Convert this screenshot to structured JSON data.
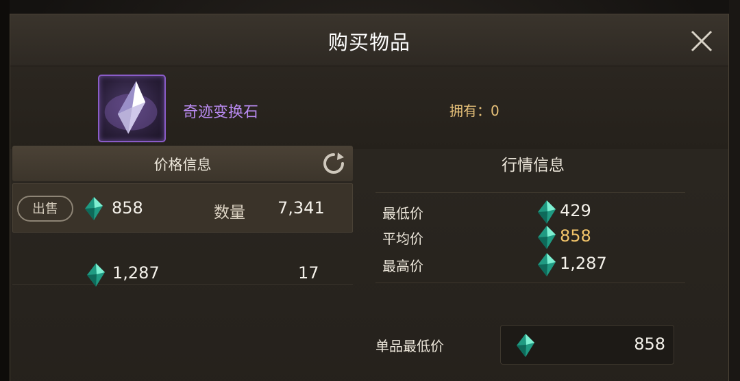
{
  "dialog": {
    "title": "购买物品",
    "close_icon": "close-icon"
  },
  "item": {
    "name": "奇迹变换石",
    "owned_text": "拥有：0",
    "icon": "crystal-icon",
    "rarity_color": "#8a5cc8"
  },
  "price_info": {
    "header": "价格信息",
    "refresh_icon": "refresh-icon",
    "orders": [
      {
        "badge": "出售",
        "price": "858",
        "qty_label": "数量",
        "qty": "7,341"
      },
      {
        "price": "1,287",
        "qty": "17"
      }
    ]
  },
  "market_info": {
    "header": "行情信息",
    "rows": [
      {
        "label": "最低价",
        "value": "429"
      },
      {
        "label": "平均价",
        "value": "858"
      },
      {
        "label": "最高价",
        "value": "1,287"
      }
    ],
    "avg_color": "#f2c46a"
  },
  "unit_price": {
    "label": "单品最低价",
    "value": "858"
  },
  "currency_icon": "green-gem-icon"
}
